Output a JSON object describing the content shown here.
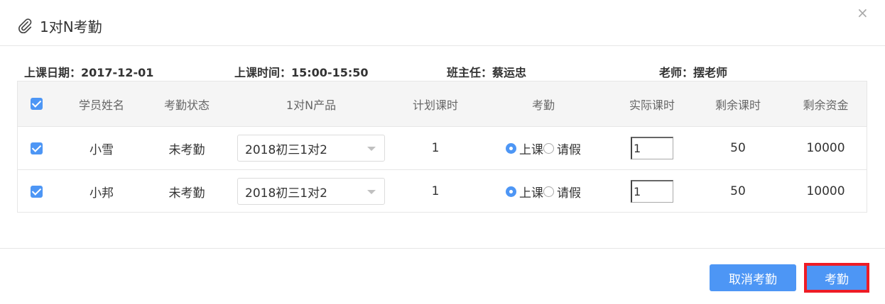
{
  "dialog": {
    "title": "1对N考勤",
    "close_label": "×"
  },
  "info": {
    "date": "上课日期：2017-12-01",
    "time": "上课时间：15:00-15:50",
    "head_teacher": "班主任：蔡运忠",
    "teacher": "老师：摆老师"
  },
  "table": {
    "headers": [
      "学员姓名",
      "考勤状态",
      "1对N产品",
      "计划课时",
      "考勤",
      "实际课时",
      "剩余课时",
      "剩余资金"
    ],
    "rows": [
      {
        "checked": true,
        "name": "小雪",
        "status": "未考勤",
        "product": "2018初三1对2",
        "planned": "1",
        "attend_label": "上课",
        "leave_label": "请假",
        "actual": "1",
        "remaining_hours": "50",
        "remaining_funds": "10000"
      },
      {
        "checked": true,
        "name": "小邦",
        "status": "未考勤",
        "product": "2018初三1对2",
        "planned": "1",
        "attend_label": "上课",
        "leave_label": "请假",
        "actual": "1",
        "remaining_hours": "50",
        "remaining_funds": "10000"
      }
    ]
  },
  "footer": {
    "cancel_label": "取消考勤",
    "confirm_label": "考勤"
  },
  "colors": {
    "accent": "#4d96f5",
    "highlight": "#ee1c25"
  }
}
